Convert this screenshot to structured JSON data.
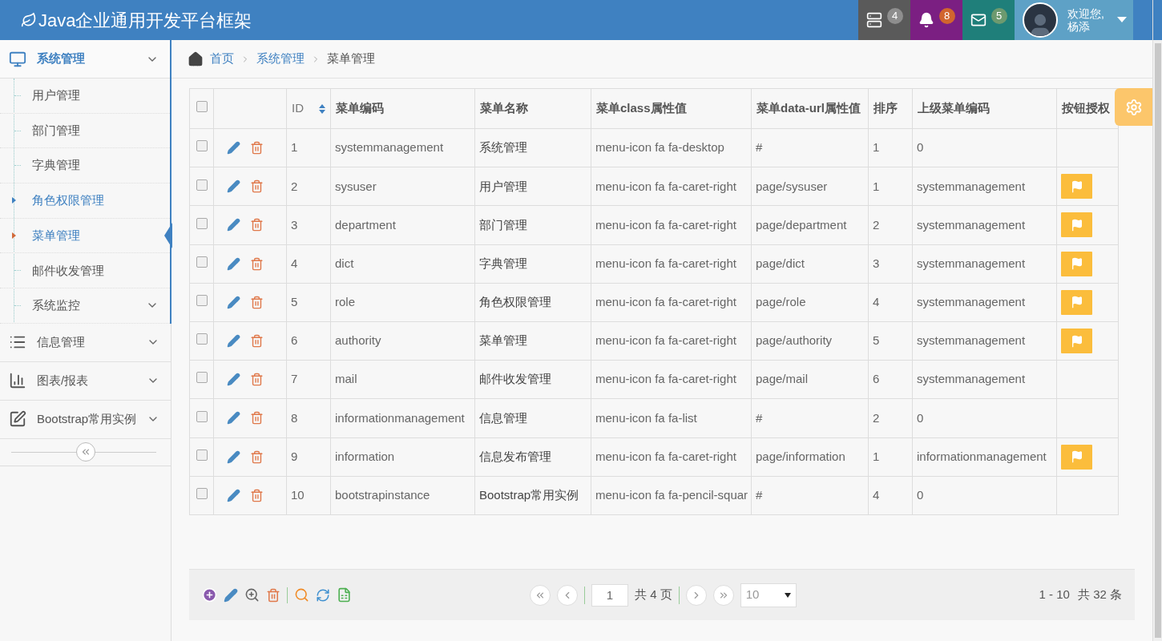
{
  "header": {
    "title": "Java企业通用开发平台框架",
    "notifications": [
      {
        "kind": "tasks",
        "count": "4",
        "color": "#5a5a5a"
      },
      {
        "kind": "bell",
        "count": "8",
        "color": "#7b1f82"
      },
      {
        "kind": "mail",
        "count": "5",
        "color": "#1f7f7a"
      }
    ],
    "user": {
      "greeting": "欢迎您,",
      "name": "杨添"
    }
  },
  "sidebar": {
    "menus": [
      {
        "label": "系统管理",
        "expanded": true,
        "children": [
          {
            "label": "用户管理",
            "selected": false,
            "hovered": false,
            "has_children": false
          },
          {
            "label": "部门管理",
            "selected": false,
            "hovered": false,
            "has_children": false
          },
          {
            "label": "字典管理",
            "selected": false,
            "hovered": false,
            "has_children": false
          },
          {
            "label": "角色权限管理",
            "selected": false,
            "hovered": true,
            "has_children": false
          },
          {
            "label": "菜单管理",
            "selected": true,
            "hovered": false,
            "has_children": false
          },
          {
            "label": "邮件收发管理",
            "selected": false,
            "hovered": false,
            "has_children": false
          },
          {
            "label": "系统监控",
            "selected": false,
            "hovered": false,
            "has_children": true
          }
        ]
      },
      {
        "label": "信息管理",
        "expanded": false
      },
      {
        "label": "图表/报表",
        "expanded": false
      },
      {
        "label": "Bootstrap常用实例",
        "expanded": false
      }
    ]
  },
  "breadcrumb": [
    {
      "label": "首页",
      "current": false
    },
    {
      "label": "系统管理",
      "current": false
    },
    {
      "label": "菜单管理",
      "current": true
    }
  ],
  "table": {
    "select_all_checked": false,
    "columns": [
      {
        "label": "ID",
        "sortable": true
      },
      {
        "label": "菜单编码",
        "sortable": false
      },
      {
        "label": "菜单名称",
        "sortable": false
      },
      {
        "label": "菜单class属性值",
        "sortable": false
      },
      {
        "label": "菜单data-url属性值",
        "sortable": false
      },
      {
        "label": "排序",
        "sortable": false
      },
      {
        "label": "上级菜单编码",
        "sortable": false
      },
      {
        "label": "按钮授权",
        "sortable": false
      }
    ],
    "rows": [
      {
        "checked": false,
        "cells": [
          "1",
          "systemmanagement",
          "系统管理",
          "menu-icon fa fa-desktop",
          "#",
          "1",
          "0"
        ],
        "authorize": false
      },
      {
        "checked": false,
        "cells": [
          "2",
          "sysuser",
          "用户管理",
          "menu-icon fa fa-caret-right",
          "page/sysuser",
          "1",
          "systemmanagement"
        ],
        "authorize": true
      },
      {
        "checked": false,
        "cells": [
          "3",
          "department",
          "部门管理",
          "menu-icon fa fa-caret-right",
          "page/department",
          "2",
          "systemmanagement"
        ],
        "authorize": true
      },
      {
        "checked": false,
        "cells": [
          "4",
          "dict",
          "字典管理",
          "menu-icon fa fa-caret-right",
          "page/dict",
          "3",
          "systemmanagement"
        ],
        "authorize": true
      },
      {
        "checked": false,
        "cells": [
          "5",
          "role",
          "角色权限管理",
          "menu-icon fa fa-caret-right",
          "page/role",
          "4",
          "systemmanagement"
        ],
        "authorize": true
      },
      {
        "checked": false,
        "cells": [
          "6",
          "authority",
          "菜单管理",
          "menu-icon fa fa-caret-right",
          "page/authority",
          "5",
          "systemmanagement"
        ],
        "authorize": true
      },
      {
        "checked": false,
        "cells": [
          "7",
          "mail",
          "邮件收发管理",
          "menu-icon fa fa-caret-right",
          "page/mail",
          "6",
          "systemmanagement"
        ],
        "authorize": false
      },
      {
        "checked": false,
        "cells": [
          "8",
          "informationmanagement",
          "信息管理",
          "menu-icon fa fa-list",
          "#",
          "2",
          "0"
        ],
        "authorize": false
      },
      {
        "checked": false,
        "cells": [
          "9",
          "information",
          "信息发布管理",
          "menu-icon fa fa-caret-right",
          "page/information",
          "1",
          "informationmanagement"
        ],
        "authorize": true
      },
      {
        "checked": false,
        "cells": [
          "10",
          "bootstrapinstance",
          "Bootstrap常用实例",
          "menu-icon fa fa-pencil-squar",
          "#",
          "4",
          "0"
        ],
        "authorize": false
      }
    ]
  },
  "pagination": {
    "page": "1",
    "total_pages": "共 4 页",
    "page_size": "10",
    "range": "1 - 10",
    "total": "共 32 条"
  }
}
